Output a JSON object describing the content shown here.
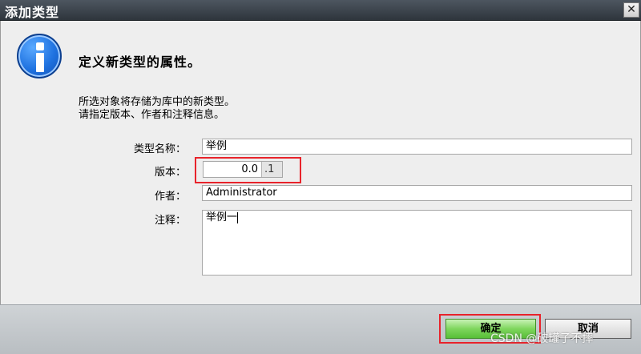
{
  "window": {
    "title": "添加类型",
    "close_glyph": "✕"
  },
  "dialog": {
    "icon": "info-icon",
    "heading": "定义新类型的属性。",
    "description_line1": "所选对象将存储为库中的新类型。",
    "description_line2": "请指定版本、作者和注释信息。"
  },
  "form": {
    "type_name": {
      "label": "类型名称：",
      "value": "举例"
    },
    "version": {
      "label": "版本：",
      "major": "0.0",
      "minor": ".1"
    },
    "author": {
      "label": "作者：",
      "value": "Administrator"
    },
    "comment": {
      "label": "注释：",
      "value": "举例一"
    }
  },
  "buttons": {
    "ok": "确定",
    "cancel": "取消"
  },
  "watermark": "CSDN @破罐子不摔",
  "colors": {
    "title_bar": "#3b434b",
    "ok_button": "#7fd65e",
    "highlight": "#e8232b",
    "info_icon": "#1f72e0"
  }
}
